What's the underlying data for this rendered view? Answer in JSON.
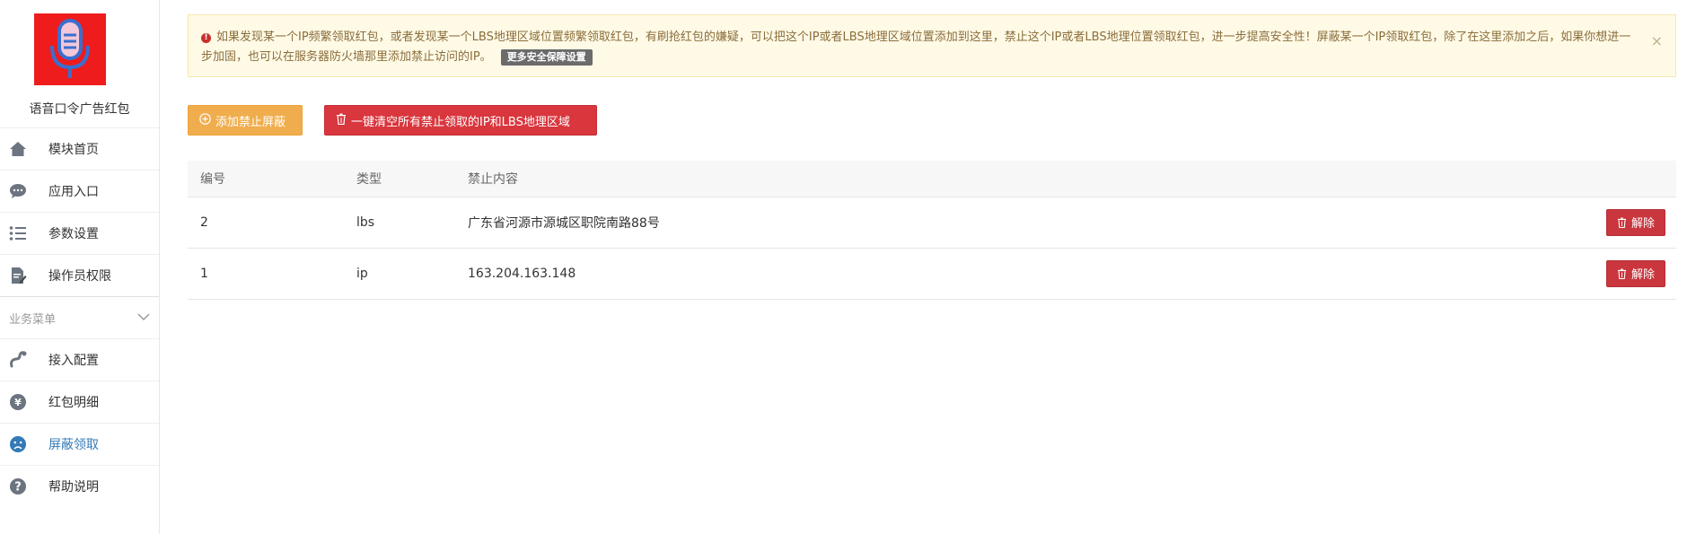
{
  "sidebar": {
    "app_name": "语音口令广告红包",
    "items": [
      {
        "label": "模块首页",
        "icon": "home-icon"
      },
      {
        "label": "应用入口",
        "icon": "chat-icon"
      },
      {
        "label": "参数设置",
        "icon": "list-icon"
      },
      {
        "label": "操作员权限",
        "icon": "edit-doc-icon"
      }
    ],
    "section_label": "业务菜单",
    "business_items": [
      {
        "label": "接入配置",
        "icon": "link-icon"
      },
      {
        "label": "红包明细",
        "icon": "yen-icon"
      },
      {
        "label": "屏蔽领取",
        "icon": "frown-icon",
        "active": true
      },
      {
        "label": "帮助说明",
        "icon": "help-icon"
      }
    ]
  },
  "alert": {
    "text": "如果发现某一个IP频繁领取红包，或者发现某一个LBS地理区域位置频繁领取红包，有刷抢红包的嫌疑，可以把这个IP或者LBS地理区域位置添加到这里，禁止这个IP或者LBS地理位置领取红包，进一步提高安全性！屏蔽某一个IP领取红包，除了在这里添加之后，如果你想进一步加固，也可以在服务器防火墙那里添加禁止访问的IP。",
    "more_label": "更多安全保障设置",
    "close": "×"
  },
  "toolbar": {
    "add_label": "添加禁止屏蔽",
    "clear_label": "一键清空所有禁止领取的IP和LBS地理区域"
  },
  "table": {
    "headers": [
      "编号",
      "类型",
      "禁止内容"
    ],
    "rows": [
      {
        "id": "2",
        "type": "lbs",
        "content": "广东省河源市源城区职院南路88号",
        "action": "解除"
      },
      {
        "id": "1",
        "type": "ip",
        "content": "163.204.163.148",
        "action": "解除"
      }
    ]
  },
  "colors": {
    "accent": "#337ab7",
    "warning": "#f0ad4e",
    "danger": "#d9363e",
    "logo_bg": "#ee1c1c"
  }
}
